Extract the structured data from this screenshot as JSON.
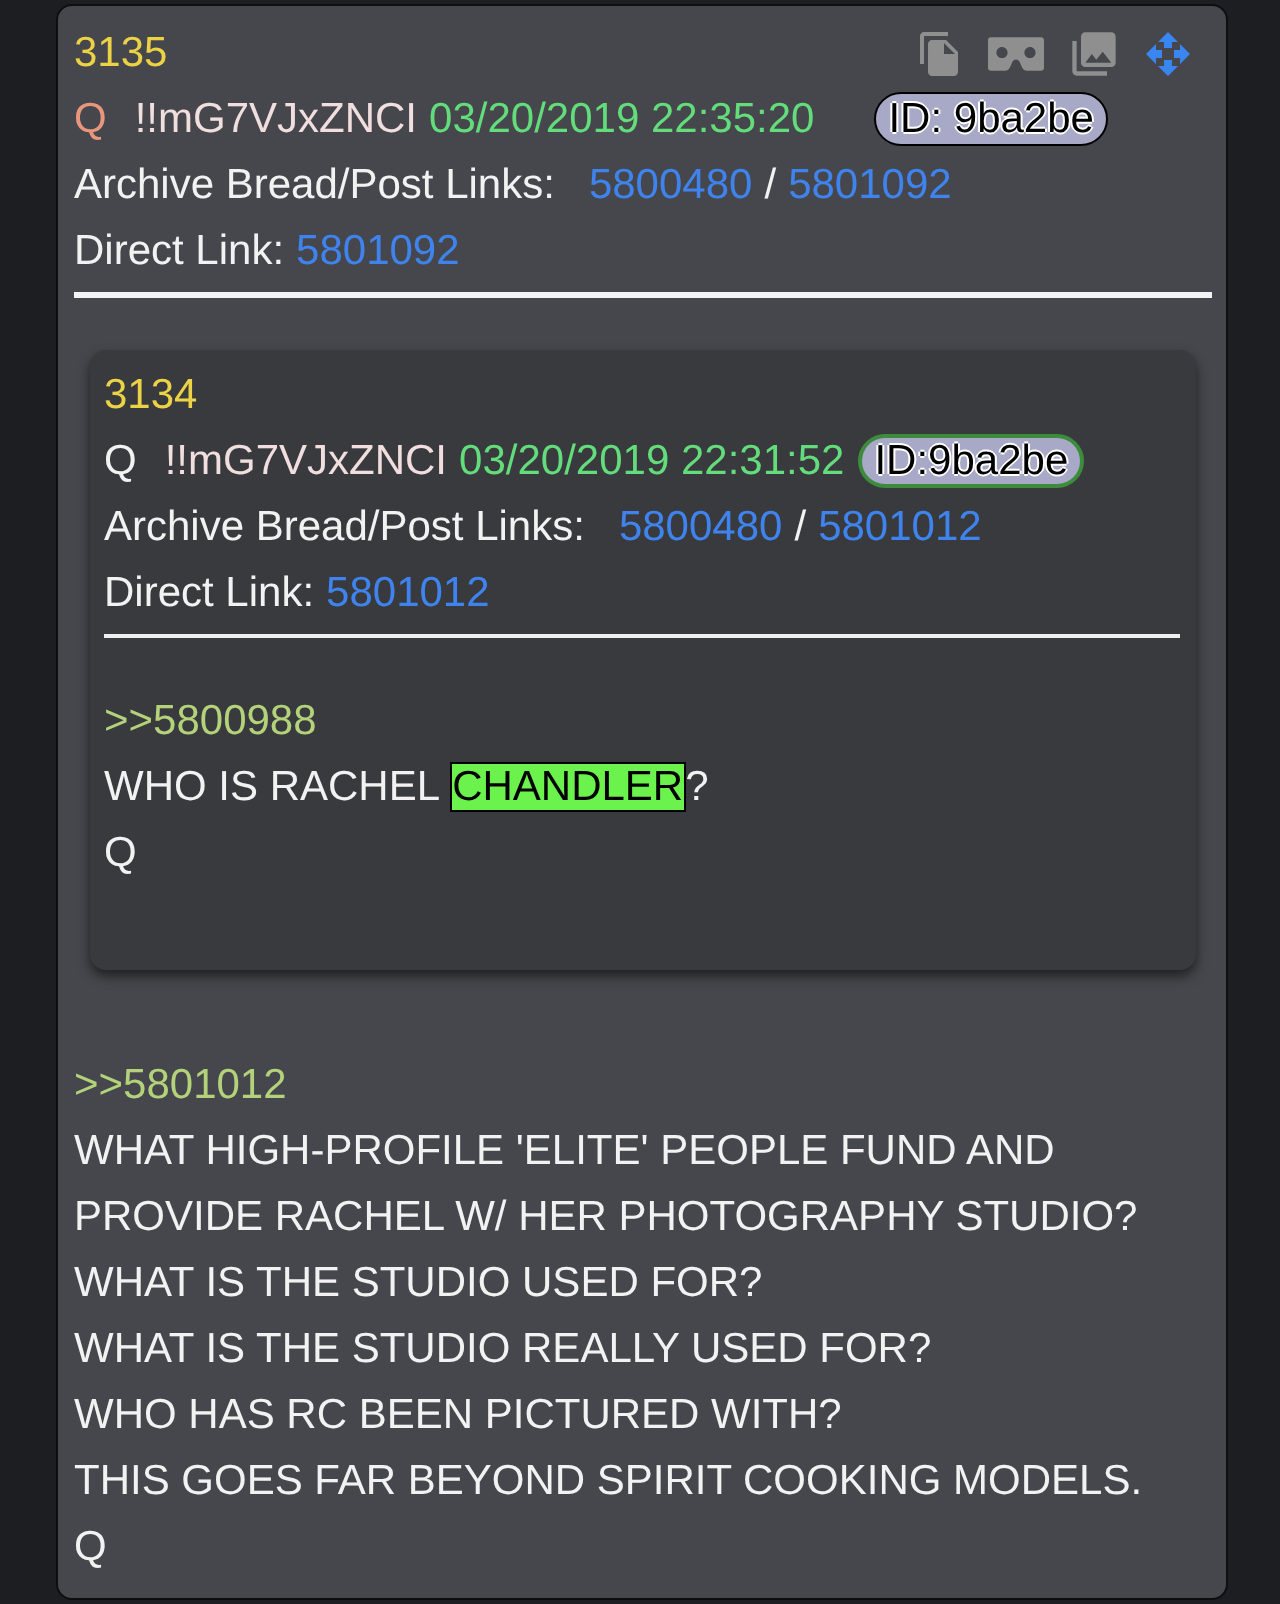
{
  "post": {
    "number": "3135",
    "author": "Q",
    "tripcode": "!!mG7VJxZNCI",
    "date": "03/20/2019 22:35:20",
    "id_badge": "ID: 9ba2be",
    "archive_label": "Archive Bread/Post Links:",
    "archive_links": [
      "5800480",
      "5801092"
    ],
    "link_separator": "/",
    "direct_link_label": "Direct Link:",
    "direct_link": "5801092",
    "quoted_post": {
      "number": "3134",
      "author": "Q",
      "tripcode": "!!mG7VJxZNCI",
      "date": "03/20/2019 22:31:52",
      "id_badge": "ID:9ba2be",
      "archive_label": "Archive Bread/Post Links:",
      "archive_links": [
        "5800480",
        "5801012"
      ],
      "link_separator": "/",
      "direct_link_label": "Direct Link:",
      "direct_link": "5801012",
      "reply_to": ">>5800988",
      "body": [
        {
          "parts": [
            {
              "text": "WHO IS RACHEL ",
              "highlighted": false
            },
            {
              "text": "CHANDLER",
              "highlighted": true
            },
            {
              "text": "?",
              "highlighted": false
            }
          ]
        },
        {
          "parts": [
            {
              "text": "Q",
              "highlighted": false
            }
          ]
        }
      ]
    },
    "reply_to": ">>5801012",
    "body": [
      {
        "parts": [
          {
            "text": "WHAT HIGH-PROFILE 'ELITE' PEOPLE FUND AND PROVIDE RACHEL W/ HER PHOTOGRAPHY STUDIO?",
            "highlighted": false
          }
        ]
      },
      {
        "parts": [
          {
            "text": "WHAT IS THE STUDIO USED FOR?",
            "highlighted": false
          }
        ]
      },
      {
        "parts": [
          {
            "text": "WHAT IS THE STUDIO REALLY USED FOR?",
            "highlighted": false
          }
        ]
      },
      {
        "parts": [
          {
            "text": "WHO HAS RC BEEN PICTURED WITH?",
            "highlighted": false
          }
        ]
      },
      {
        "parts": [
          {
            "text": "THIS GOES FAR BEYOND SPIRIT COOKING MODELS.",
            "highlighted": false
          }
        ]
      },
      {
        "parts": [
          {
            "text": "Q",
            "highlighted": false
          }
        ]
      }
    ]
  }
}
